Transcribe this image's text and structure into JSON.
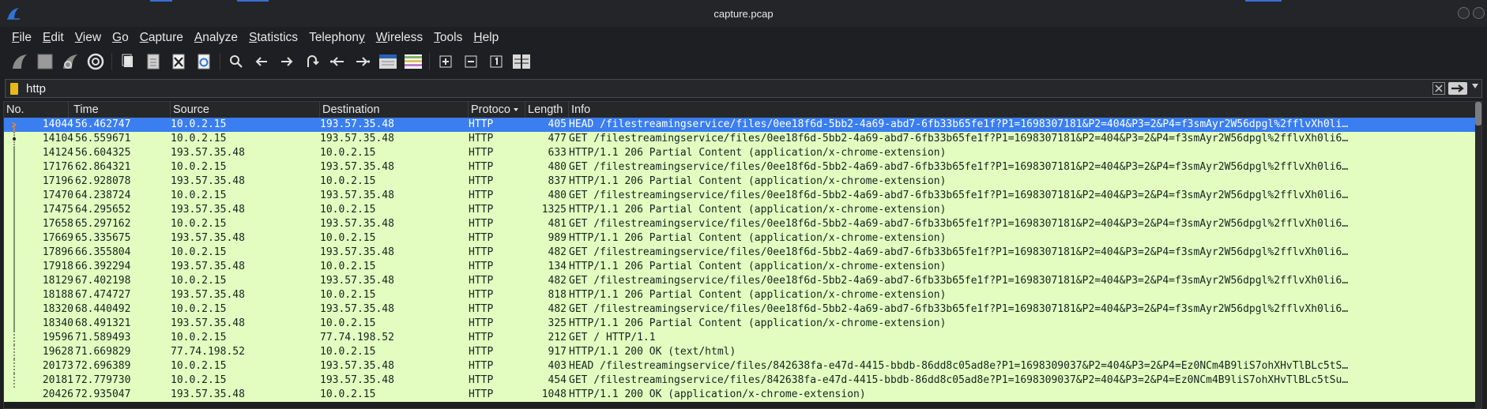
{
  "window": {
    "title": "capture.pcap"
  },
  "menu": {
    "items": [
      {
        "u": "F",
        "rest": "ile"
      },
      {
        "u": "E",
        "rest": "dit"
      },
      {
        "u": "V",
        "rest": "iew"
      },
      {
        "u": "G",
        "rest": "o"
      },
      {
        "u": "C",
        "rest": "apture"
      },
      {
        "u": "A",
        "rest": "nalyze"
      },
      {
        "u": "S",
        "rest": "tatistics"
      },
      {
        "u": "",
        "rest": "Telephon",
        "u2": "y"
      },
      {
        "u": "W",
        "rest": "ireless"
      },
      {
        "u": "T",
        "rest": "ools"
      },
      {
        "u": "H",
        "rest": "elp"
      }
    ]
  },
  "toolbar": {
    "icons": [
      "start-capture-icon",
      "stop-capture-icon",
      "restart-capture-icon",
      "capture-options-icon",
      "open-file-icon",
      "save-file-icon",
      "close-file-icon",
      "reload-file-icon",
      "find-packet-icon",
      "go-back-icon",
      "go-forward-icon",
      "go-to-packet-icon",
      "go-first-icon",
      "go-last-icon",
      "auto-scroll-icon",
      "colorize-icon",
      "zoom-in-icon",
      "zoom-out-icon",
      "normal-size-icon",
      "resize-columns-icon"
    ]
  },
  "filter": {
    "value": "http"
  },
  "columns": {
    "no": "No.",
    "time": "Time",
    "source": "Source",
    "destination": "Destination",
    "protocol": "Protoco",
    "length": "Length",
    "info": "Info"
  },
  "packets": [
    {
      "no": "14044",
      "time": "56.462747",
      "src": "10.0.2.15",
      "dst": "193.57.35.48",
      "proto": "HTTP",
      "len": "405",
      "info": "HEAD /filestreamingservice/files/0ee18f6d-5bb2-4a69-abd7-6fb33b65fe1f?P1=1698307181&P2=404&P3=2&P4=f3smAyr2W56dpgl%2fflvXh0li…",
      "selected": true
    },
    {
      "no": "14104",
      "time": "56.559671",
      "src": "10.0.2.15",
      "dst": "193.57.35.48",
      "proto": "HTTP",
      "len": "477",
      "info": "GET /filestreamingservice/files/0ee18f6d-5bb2-4a69-abd7-6fb33b65fe1f?P1=1698307181&P2=404&P3=2&P4=f3smAyr2W56dpgl%2fflvXh0li6…"
    },
    {
      "no": "14124",
      "time": "56.604325",
      "src": "193.57.35.48",
      "dst": "10.0.2.15",
      "proto": "HTTP",
      "len": "633",
      "info": "HTTP/1.1 206 Partial Content  (application/x-chrome-extension)"
    },
    {
      "no": "17176",
      "time": "62.864321",
      "src": "10.0.2.15",
      "dst": "193.57.35.48",
      "proto": "HTTP",
      "len": "480",
      "info": "GET /filestreamingservice/files/0ee18f6d-5bb2-4a69-abd7-6fb33b65fe1f?P1=1698307181&P2=404&P3=2&P4=f3smAyr2W56dpgl%2fflvXh0li6…"
    },
    {
      "no": "17196",
      "time": "62.928078",
      "src": "193.57.35.48",
      "dst": "10.0.2.15",
      "proto": "HTTP",
      "len": "837",
      "info": "HTTP/1.1 206 Partial Content  (application/x-chrome-extension)"
    },
    {
      "no": "17470",
      "time": "64.238724",
      "src": "10.0.2.15",
      "dst": "193.57.35.48",
      "proto": "HTTP",
      "len": "480",
      "info": "GET /filestreamingservice/files/0ee18f6d-5bb2-4a69-abd7-6fb33b65fe1f?P1=1698307181&P2=404&P3=2&P4=f3smAyr2W56dpgl%2fflvXh0li6…"
    },
    {
      "no": "17475",
      "time": "64.295652",
      "src": "193.57.35.48",
      "dst": "10.0.2.15",
      "proto": "HTTP",
      "len": "1325",
      "info": "HTTP/1.1 206 Partial Content  (application/x-chrome-extension)"
    },
    {
      "no": "17658",
      "time": "65.297162",
      "src": "10.0.2.15",
      "dst": "193.57.35.48",
      "proto": "HTTP",
      "len": "481",
      "info": "GET /filestreamingservice/files/0ee18f6d-5bb2-4a69-abd7-6fb33b65fe1f?P1=1698307181&P2=404&P3=2&P4=f3smAyr2W56dpgl%2fflvXh0li6…"
    },
    {
      "no": "17669",
      "time": "65.335675",
      "src": "193.57.35.48",
      "dst": "10.0.2.15",
      "proto": "HTTP",
      "len": "989",
      "info": "HTTP/1.1 206 Partial Content  (application/x-chrome-extension)"
    },
    {
      "no": "17896",
      "time": "66.355804",
      "src": "10.0.2.15",
      "dst": "193.57.35.48",
      "proto": "HTTP",
      "len": "482",
      "info": "GET /filestreamingservice/files/0ee18f6d-5bb2-4a69-abd7-6fb33b65fe1f?P1=1698307181&P2=404&P3=2&P4=f3smAyr2W56dpgl%2fflvXh0li6…"
    },
    {
      "no": "17918",
      "time": "66.392294",
      "src": "193.57.35.48",
      "dst": "10.0.2.15",
      "proto": "HTTP",
      "len": "134",
      "info": "HTTP/1.1 206 Partial Content  (application/x-chrome-extension)"
    },
    {
      "no": "18129",
      "time": "67.402198",
      "src": "10.0.2.15",
      "dst": "193.57.35.48",
      "proto": "HTTP",
      "len": "482",
      "info": "GET /filestreamingservice/files/0ee18f6d-5bb2-4a69-abd7-6fb33b65fe1f?P1=1698307181&P2=404&P3=2&P4=f3smAyr2W56dpgl%2fflvXh0li6…"
    },
    {
      "no": "18188",
      "time": "67.474727",
      "src": "193.57.35.48",
      "dst": "10.0.2.15",
      "proto": "HTTP",
      "len": "818",
      "info": "HTTP/1.1 206 Partial Content  (application/x-chrome-extension)"
    },
    {
      "no": "18320",
      "time": "68.440492",
      "src": "10.0.2.15",
      "dst": "193.57.35.48",
      "proto": "HTTP",
      "len": "482",
      "info": "GET /filestreamingservice/files/0ee18f6d-5bb2-4a69-abd7-6fb33b65fe1f?P1=1698307181&P2=404&P3=2&P4=f3smAyr2W56dpgl%2fflvXh0li6…"
    },
    {
      "no": "18340",
      "time": "68.491321",
      "src": "193.57.35.48",
      "dst": "10.0.2.15",
      "proto": "HTTP",
      "len": "325",
      "info": "HTTP/1.1 206 Partial Content  (application/x-chrome-extension)"
    },
    {
      "no": "19596",
      "time": "71.589493",
      "src": "10.0.2.15",
      "dst": "77.74.198.52",
      "proto": "HTTP",
      "len": "212",
      "info": "GET / HTTP/1.1"
    },
    {
      "no": "19628",
      "time": "71.669829",
      "src": "77.74.198.52",
      "dst": "10.0.2.15",
      "proto": "HTTP",
      "len": "917",
      "info": "HTTP/1.1 200 OK  (text/html)"
    },
    {
      "no": "20173",
      "time": "72.696389",
      "src": "10.0.2.15",
      "dst": "193.57.35.48",
      "proto": "HTTP",
      "len": "403",
      "info": "HEAD /filestreamingservice/files/842638fa-e47d-4415-bbdb-86dd8c05ad8e?P1=1698309037&P2=404&P3=2&P4=Ez0NCm4B9liS7ohXHvTlBLc5tS…"
    },
    {
      "no": "20181",
      "time": "72.779730",
      "src": "10.0.2.15",
      "dst": "193.57.35.48",
      "proto": "HTTP",
      "len": "454",
      "info": "GET /filestreamingservice/files/842638fa-e47d-4415-bbdb-86dd8c05ad8e?P1=1698309037&P2=404&P3=2&P4=Ez0NCm4B9liS7ohXHvTlBLc5tSu…"
    },
    {
      "no": "20426",
      "time": "72.935047",
      "src": "193.57.35.48",
      "dst": "10.0.2.15",
      "proto": "HTTP",
      "len": "1048",
      "info": "HTTP/1.1 200 OK  (application/x-chrome-extension)"
    }
  ],
  "colors": {
    "http_row_bg": "#e3fcc0",
    "selected_row_bg": "#3a7ef0",
    "accent": "#3b6ed6"
  }
}
